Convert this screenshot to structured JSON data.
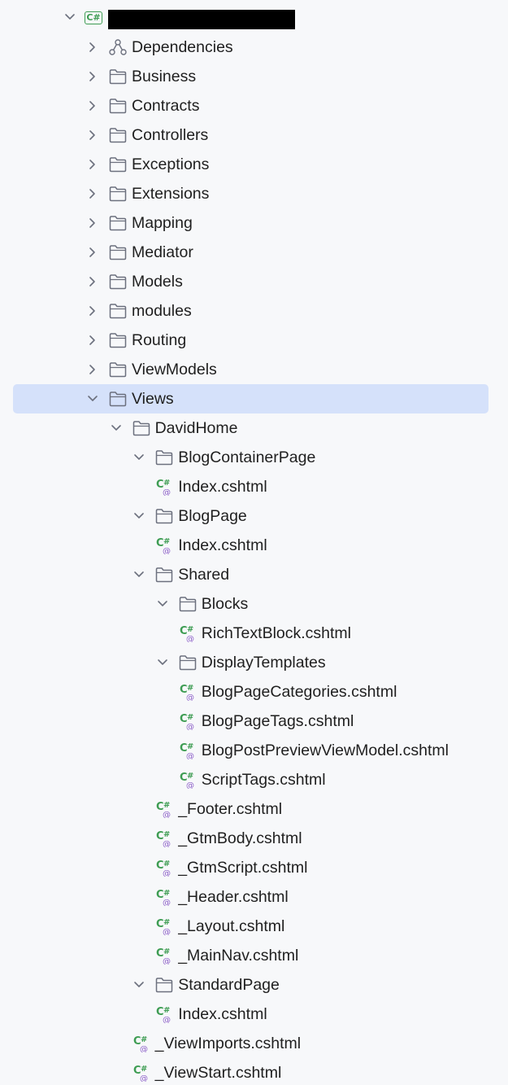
{
  "project": {
    "badge": "C#",
    "name": "",
    "name_redacted": true
  },
  "colors": {
    "background": "#f7f8fa",
    "selection": "#d5e1fa",
    "cshtml_green": "#3d9c52",
    "cshtml_at_purple": "#8a5cc7",
    "folder_stroke": "#6c707e"
  },
  "tree": [
    {
      "label": "Dependencies",
      "kind": "dependencies",
      "depth": 0,
      "expanded": false
    },
    {
      "label": "Business",
      "kind": "folder",
      "depth": 0,
      "expanded": false
    },
    {
      "label": "Contracts",
      "kind": "folder",
      "depth": 0,
      "expanded": false
    },
    {
      "label": "Controllers",
      "kind": "folder",
      "depth": 0,
      "expanded": false
    },
    {
      "label": "Exceptions",
      "kind": "folder",
      "depth": 0,
      "expanded": false
    },
    {
      "label": "Extensions",
      "kind": "folder",
      "depth": 0,
      "expanded": false
    },
    {
      "label": "Mapping",
      "kind": "folder",
      "depth": 0,
      "expanded": false
    },
    {
      "label": "Mediator",
      "kind": "folder",
      "depth": 0,
      "expanded": false
    },
    {
      "label": "Models",
      "kind": "folder",
      "depth": 0,
      "expanded": false
    },
    {
      "label": "modules",
      "kind": "folder",
      "depth": 0,
      "expanded": false
    },
    {
      "label": "Routing",
      "kind": "folder",
      "depth": 0,
      "expanded": false
    },
    {
      "label": "ViewModels",
      "kind": "folder",
      "depth": 0,
      "expanded": false
    },
    {
      "label": "Views",
      "kind": "folder",
      "depth": 0,
      "expanded": true,
      "selected": true
    },
    {
      "label": "DavidHome",
      "kind": "folder",
      "depth": 1,
      "expanded": true
    },
    {
      "label": "BlogContainerPage",
      "kind": "folder",
      "depth": 2,
      "expanded": true
    },
    {
      "label": "Index.cshtml",
      "kind": "file",
      "depth": 3
    },
    {
      "label": "BlogPage",
      "kind": "folder",
      "depth": 2,
      "expanded": true
    },
    {
      "label": "Index.cshtml",
      "kind": "file",
      "depth": 3
    },
    {
      "label": "Shared",
      "kind": "folder",
      "depth": 2,
      "expanded": true
    },
    {
      "label": "Blocks",
      "kind": "folder",
      "depth": 3,
      "expanded": true
    },
    {
      "label": "RichTextBlock.cshtml",
      "kind": "file",
      "depth": 4
    },
    {
      "label": "DisplayTemplates",
      "kind": "folder",
      "depth": 3,
      "expanded": true
    },
    {
      "label": "BlogPageCategories.cshtml",
      "kind": "file",
      "depth": 4
    },
    {
      "label": "BlogPageTags.cshtml",
      "kind": "file",
      "depth": 4
    },
    {
      "label": "BlogPostPreviewViewModel.cshtml",
      "kind": "file",
      "depth": 4
    },
    {
      "label": "ScriptTags.cshtml",
      "kind": "file",
      "depth": 4
    },
    {
      "label": "_Footer.cshtml",
      "kind": "file",
      "depth": 3
    },
    {
      "label": "_GtmBody.cshtml",
      "kind": "file",
      "depth": 3
    },
    {
      "label": "_GtmScript.cshtml",
      "kind": "file",
      "depth": 3
    },
    {
      "label": "_Header.cshtml",
      "kind": "file",
      "depth": 3
    },
    {
      "label": "_Layout.cshtml",
      "kind": "file",
      "depth": 3
    },
    {
      "label": "_MainNav.cshtml",
      "kind": "file",
      "depth": 3
    },
    {
      "label": "StandardPage",
      "kind": "folder",
      "depth": 2,
      "expanded": true
    },
    {
      "label": "Index.cshtml",
      "kind": "file",
      "depth": 3
    },
    {
      "label": "_ViewImports.cshtml",
      "kind": "file",
      "depth": 2
    },
    {
      "label": "_ViewStart.cshtml",
      "kind": "file",
      "depth": 2
    }
  ]
}
